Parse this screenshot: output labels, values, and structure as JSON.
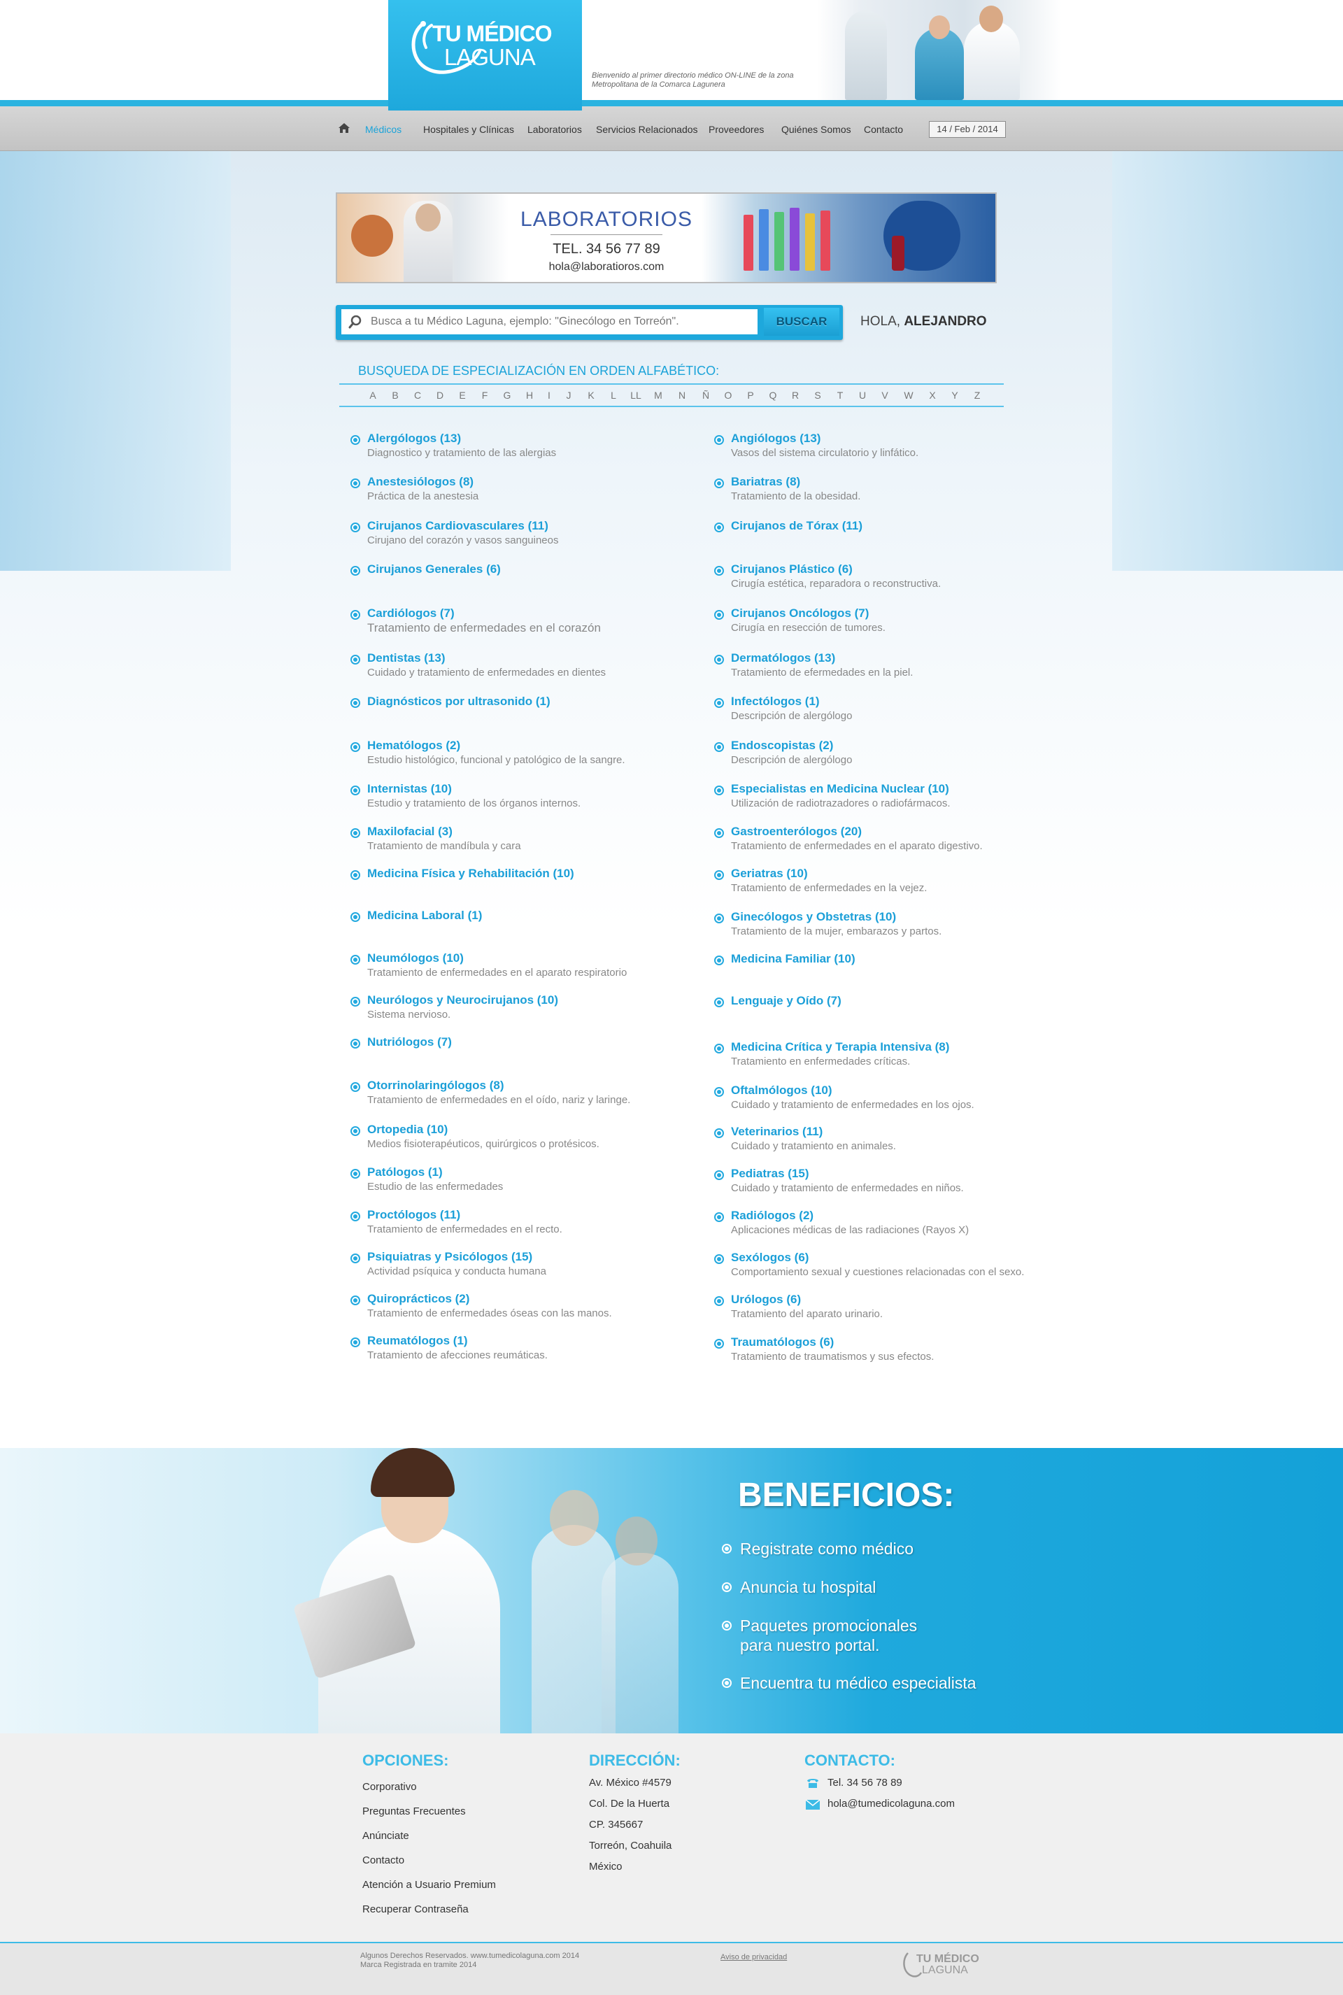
{
  "header": {
    "logo_line1": "TU MÉDICO",
    "logo_line2": "LAGUNA",
    "tagline": "Bienvenido al primer directorio médico ON-LINE de la zona Metropolitana de la Comarca Lagunera"
  },
  "nav": {
    "items": [
      "Médicos",
      "Hospitales y Clínicas",
      "Laboratorios",
      "Servicios Relacionados",
      "Proveedores",
      "Quiénes Somos",
      "Contacto"
    ],
    "date": "14 / Feb / 2014"
  },
  "lab_banner": {
    "title": "LABORATORIOS",
    "tel": "TEL. 34 56 77 89",
    "email": "hola@laboratioros.com"
  },
  "search": {
    "placeholder": "Busca a tu Médico Laguna, ejemplo: \"Ginecólogo en Torreón\".",
    "button": "BUSCAR",
    "greeting": "HOLA,",
    "user": "ALEJANDRO"
  },
  "alphabet": {
    "title": "BUSQUEDA DE ESPECIALIZACIÓN EN ORDEN ALFABÉTICO:",
    "letters": [
      "A",
      "B",
      "C",
      "D",
      "E",
      "F",
      "G",
      "H",
      "I",
      "J",
      "K",
      "L",
      "LL",
      "M",
      "N",
      "Ñ",
      "O",
      "P",
      "Q",
      "R",
      "S",
      "T",
      "U",
      "V",
      "W",
      "X",
      "Y",
      "Z"
    ]
  },
  "specialties_left": [
    {
      "name": "Alergólogos (13)",
      "desc": "Diagnostico y tratamiento de las alergias"
    },
    {
      "name": "Anestesiólogos (8)",
      "desc": "Práctica de la anestesia"
    },
    {
      "name": "Cirujanos Cardiovasculares (11)",
      "desc": "Cirujano del corazón y vasos sanguineos"
    },
    {
      "name": "Cirujanos Generales (6)",
      "desc": ""
    },
    {
      "name": "Cardiólogos (7)",
      "desc": "Tratamiento de enfermedades en el corazón"
    },
    {
      "name": "Dentistas (13)",
      "desc": "Cuidado y tratamiento de enfermedades en dientes"
    },
    {
      "name": "Diagnósticos por ultrasonido (1)",
      "desc": ""
    },
    {
      "name": "Hematólogos (2)",
      "desc": "Estudio histológico, funcional y patológico de la sangre."
    },
    {
      "name": "Internistas (10)",
      "desc": "Estudio y tratamiento de los órganos internos."
    },
    {
      "name": "Maxilofacial (3)",
      "desc": "Tratamiento de mandíbula y cara"
    },
    {
      "name": "Medicina Física y Rehabilitación (10)",
      "desc": ""
    },
    {
      "name": "Medicina Laboral (1)",
      "desc": ""
    },
    {
      "name": "Neumólogos (10)",
      "desc": "Tratamiento de enfermedades en el aparato respiratorio"
    },
    {
      "name": "Neurólogos y Neurocirujanos (10)",
      "desc": "Sistema nervioso."
    },
    {
      "name": "Nutriólogos (7)",
      "desc": ""
    },
    {
      "name": "Otorrinolaringólogos (8)",
      "desc": "Tratamiento de enfermedades en el oído, nariz y laringe."
    },
    {
      "name": "Ortopedia (10)",
      "desc": "Medios fisioterapéuticos, quirúrgicos o protésicos."
    },
    {
      "name": "Patólogos (1)",
      "desc": "Estudio de las enfermedades"
    },
    {
      "name": "Proctólogos (11)",
      "desc": "Tratamiento de enfermedades en el recto."
    },
    {
      "name": "Psiquiatras y Psicólogos (15)",
      "desc": "Actividad psíquica y conducta humana"
    },
    {
      "name": "Quiroprácticos (2)",
      "desc": "Tratamiento de enfermedades óseas con las manos."
    },
    {
      "name": "Reumatólogos (1)",
      "desc": "Tratamiento de afecciones reumáticas."
    }
  ],
  "specialties_right": [
    {
      "name": "Angiólogos (13)",
      "desc": "Vasos del sistema circulatorio y linfático."
    },
    {
      "name": "Bariatras (8)",
      "desc": "Tratamiento de la obesidad."
    },
    {
      "name": "Cirujanos de Tórax (11)",
      "desc": ""
    },
    {
      "name": "Cirujanos Plástico (6)",
      "desc": "Cirugía estética, reparadora o reconstructiva."
    },
    {
      "name": "Cirujanos Oncólogos (7)",
      "desc": "Cirugía en resección de tumores."
    },
    {
      "name": "Dermatólogos (13)",
      "desc": "Tratamiento de efermedades en la piel."
    },
    {
      "name": "Infectólogos (1)",
      "desc": "Descripción de alergólogo"
    },
    {
      "name": "Endoscopistas (2)",
      "desc": "Descripción de alergólogo"
    },
    {
      "name": "Especialistas en Medicina Nuclear (10)",
      "desc": "Utilización de radiotrazadores o radiofármacos."
    },
    {
      "name": "Gastroenterólogos (20)",
      "desc": "Tratamiento de enfermedades en el aparato digestivo."
    },
    {
      "name": "Geriatras (10)",
      "desc": "Tratamiento de enfermedades en la vejez."
    },
    {
      "name": "Ginecólogos y Obstetras (10)",
      "desc": "Tratamiento de la mujer, embarazos y partos."
    },
    {
      "name": "Medicina Familiar (10)",
      "desc": ""
    },
    {
      "name": "Lenguaje y Oído (7)",
      "desc": ""
    },
    {
      "name": "Medicina Crítica y Terapia Intensiva (8)",
      "desc": "Tratamiento en enfermedades críticas."
    },
    {
      "name": "Oftalmólogos (10)",
      "desc": "Cuidado y tratamiento de enfermedades en los ojos."
    },
    {
      "name": "Veterinarios (11)",
      "desc": "Cuidado y tratamiento en animales."
    },
    {
      "name": "Pediatras (15)",
      "desc": "Cuidado y tratamiento de enfermedades en niños."
    },
    {
      "name": "Radiólogos (2)",
      "desc": "Aplicaciones médicas de las radiaciones (Rayos X)"
    },
    {
      "name": "Sexólogos (6)",
      "desc": "Comportamiento sexual y cuestiones relacionadas con el sexo."
    },
    {
      "name": "Urólogos (6)",
      "desc": "Tratamiento del aparato urinario."
    },
    {
      "name": "Traumatólogos (6)",
      "desc": "Tratamiento de traumatismos y sus efectos."
    }
  ],
  "beneficios": {
    "title": "BENEFICIOS",
    "colon": ":",
    "items": [
      "Registrate como médico",
      "Anuncia tu hospital",
      "Paquetes promocionales",
      "para nuestro portal.",
      "Encuentra tu médico especialista"
    ]
  },
  "footer": {
    "opciones_title": "OPCIONES:",
    "opciones": [
      "Corporativo",
      "Preguntas Frecuentes",
      "Anúnciate",
      "Contacto",
      "Atención a Usuario Premium",
      "Recuperar Contraseña"
    ],
    "direccion_title": "DIRECCIÓN:",
    "direccion": [
      "Av. México #4579",
      "Col. De la Huerta",
      "CP. 345667",
      "Torreón, Coahuila",
      "México"
    ],
    "contacto_title": "CONTACTO:",
    "tel": "Tel. 34 56 78 89",
    "email": "hola@tumedicolaguna.com",
    "copyright1": "Algunos Derechos Reservados. www.tumedicolaguna.com 2014",
    "copyright2": "Marca Registrada en tramite 2014",
    "privacy": "Aviso de privacidad",
    "logo_line1": "TU MÉDICO",
    "logo_line2": "LAGUNA"
  },
  "colors": {
    "accent": "#1ea8dc",
    "nav_bg": "#cfcfcf",
    "link": "#1b9fd8"
  }
}
